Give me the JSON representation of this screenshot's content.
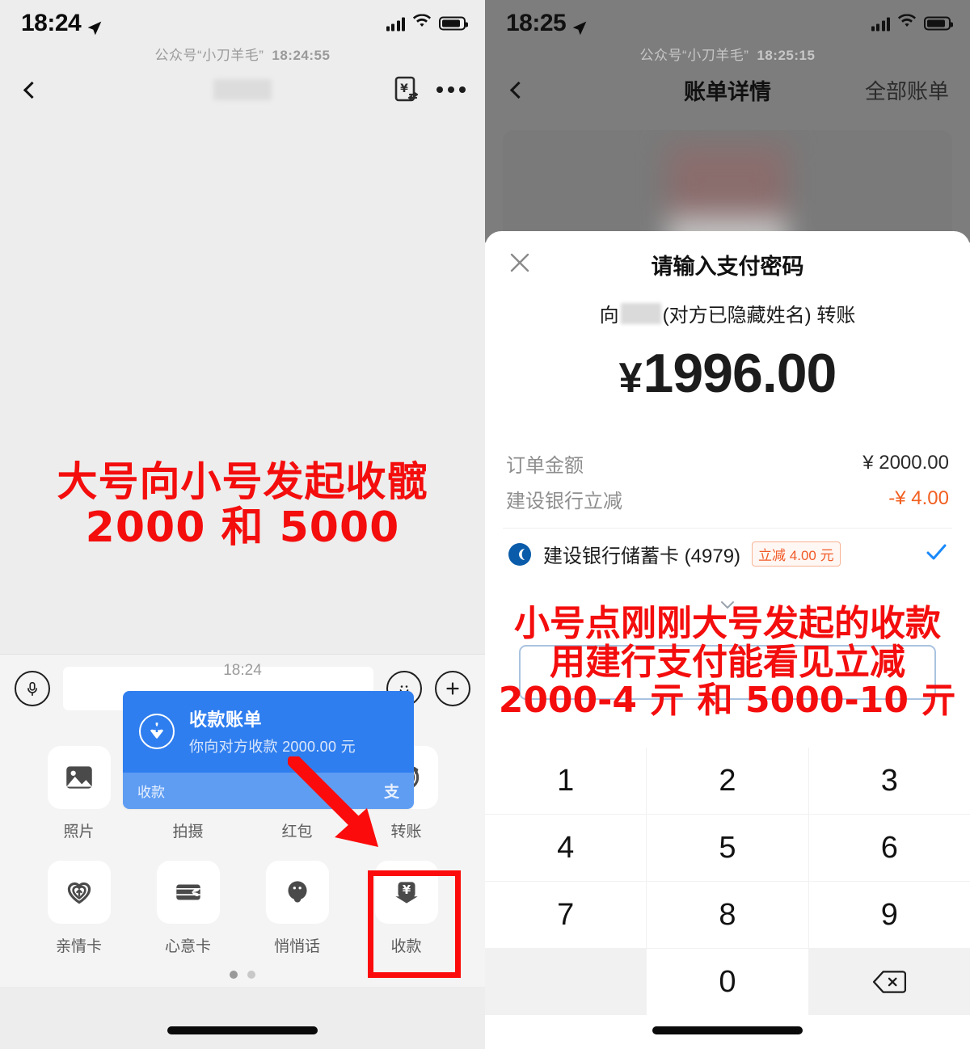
{
  "left": {
    "status": {
      "time": "18:24",
      "location_icon": "location-arrow-icon"
    },
    "watermark": {
      "account": "公众号“小刀羊毛”",
      "time": "18:24:55"
    },
    "nav": {
      "back_icon": "chevron-left-icon",
      "bill_icon": "transfer-bill-icon",
      "more_icon": "more-dots-icon"
    },
    "annotation": {
      "line1": "大号向小号发起收髋",
      "line2": "2000 和 5000"
    },
    "message": {
      "time": "18:24",
      "title": "收款账单",
      "subtitle": "你向对方收款 2000.00 元",
      "footer_label": "收款",
      "footer_brand": "支",
      "icon": "yen-down-arrow-icon"
    },
    "input": {
      "voice_icon": "microphone-icon",
      "text_value": "",
      "text_placeholder": "",
      "emoji_icon": "smiley-icon",
      "plus_icon": "plus-icon"
    },
    "panel": {
      "items": [
        {
          "label": "照片",
          "icon": "photo-icon"
        },
        {
          "label": "拍摄",
          "icon": "camera-icon"
        },
        {
          "label": "红包",
          "icon": "red-packet-icon"
        },
        {
          "label": "转账",
          "icon": "transfer-yen-icon"
        },
        {
          "label": "亲情卡",
          "icon": "family-card-icon"
        },
        {
          "label": "心意卡",
          "icon": "gift-card-icon"
        },
        {
          "label": "悄悄话",
          "icon": "whisper-face-icon"
        },
        {
          "label": "收款",
          "icon": "receive-money-icon"
        }
      ],
      "pages": 2,
      "active_page": 1
    }
  },
  "right": {
    "status": {
      "time": "18:25",
      "location_icon": "location-arrow-icon"
    },
    "watermark": {
      "account": "公众号“小刀羊毛”",
      "time": "18:25:15"
    },
    "nav": {
      "back_icon": "chevron-left-icon",
      "title": "账单详情",
      "action": "全部账单"
    },
    "sheet": {
      "close_icon": "close-x-icon",
      "title": "请输入支付密码",
      "to_prefix": "向",
      "to_suffix": "(对方已隐藏姓名) 转账",
      "currency": "¥",
      "amount": "1996.00",
      "rows": [
        {
          "label": "订单金额",
          "value": "¥ 2000.00",
          "negative": false
        },
        {
          "label": "建设银行立减",
          "value": "-¥ 4.00",
          "negative": true
        }
      ],
      "card": {
        "logo_icon": "ccb-bank-icon",
        "name": "建设银行储蓄卡 (4979)",
        "tag": "立减 4.00 元",
        "selected_icon": "checkmark-icon",
        "expand_icon": "chevron-down-icon"
      },
      "password_value": ""
    },
    "annotation": {
      "line1": "小号点刚刚大号发起的收款",
      "line2": "用建行支付能看见立减",
      "line3": "2000-4 亓 和 5000-10 亓"
    },
    "keypad": {
      "keys": [
        "1",
        "2",
        "3",
        "4",
        "5",
        "6",
        "7",
        "8",
        "9",
        "",
        "0",
        "delete"
      ],
      "delete_icon": "backspace-icon"
    }
  },
  "colors": {
    "annotation_red": "#f40d0d",
    "bubble_blue": "#2f7eef",
    "discount_orange": "#f26022",
    "check_blue": "#1989fa",
    "dim_overlay": "#7d7d7d"
  }
}
